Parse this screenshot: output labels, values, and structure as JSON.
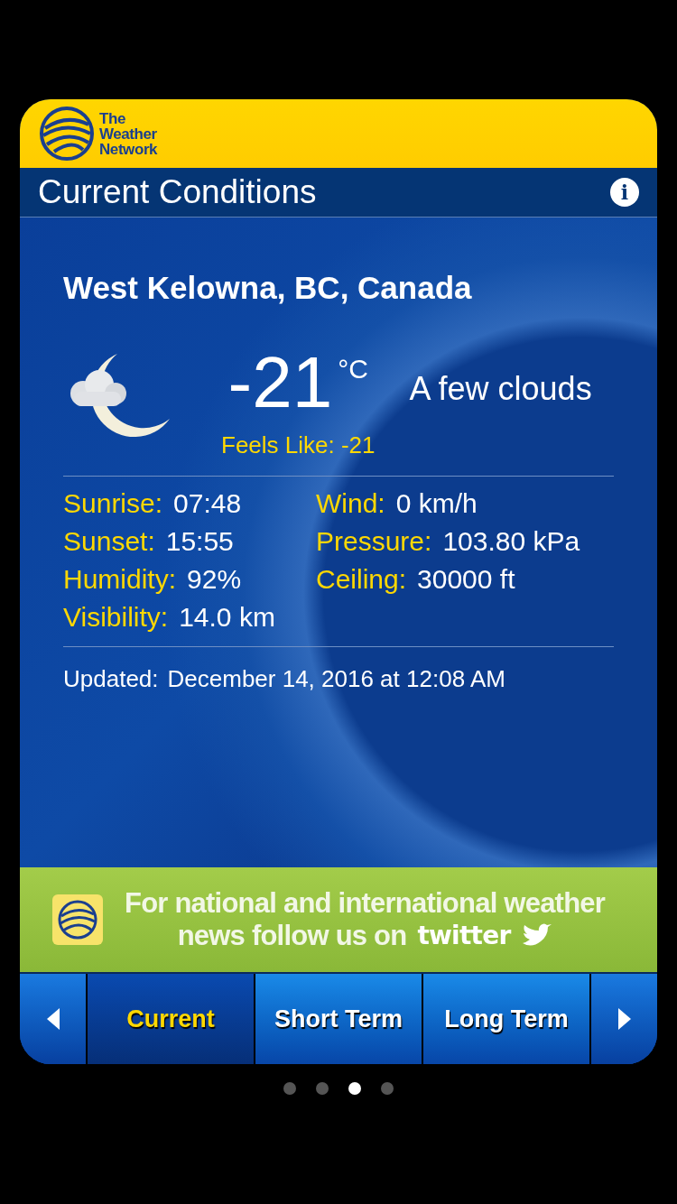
{
  "header": {
    "logo_lines": [
      "The",
      "Weather",
      "Network"
    ]
  },
  "title_bar": {
    "title": "Current Conditions",
    "info": "i"
  },
  "location": "West Kelowna, BC, Canada",
  "current": {
    "temperature": "-21",
    "unit": "°C",
    "condition": "A few clouds",
    "feels_like": "Feels Like: -21"
  },
  "stats": [
    {
      "label": "Sunrise:",
      "value": "07:48"
    },
    {
      "label": "Wind:",
      "value": "0 km/h"
    },
    {
      "label": "Sunset:",
      "value": "15:55"
    },
    {
      "label": "Pressure:",
      "value": "103.80 kPa"
    },
    {
      "label": "Humidity:",
      "value": "92%"
    },
    {
      "label": "Ceiling:",
      "value": "30000 ft"
    },
    {
      "label": "Visibility:",
      "value": "14.0 km"
    }
  ],
  "updated": {
    "label": "Updated:",
    "value": "December 14, 2016 at 12:08 AM"
  },
  "banner": {
    "line_1": "For national and international weather",
    "line_2": "news follow us on",
    "brand": "twitter"
  },
  "tabs": [
    {
      "label": "Current",
      "selected": true
    },
    {
      "label": "Short Term",
      "selected": false
    },
    {
      "label": "Long Term",
      "selected": false
    }
  ],
  "pages": [
    {
      "selected": false
    },
    {
      "selected": false
    },
    {
      "selected": true
    },
    {
      "selected": false
    }
  ]
}
